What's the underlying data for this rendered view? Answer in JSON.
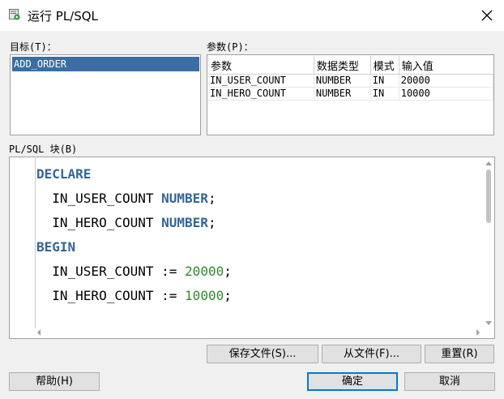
{
  "window": {
    "title": "运行 PL/SQL"
  },
  "target": {
    "label": "目标(T)：",
    "items": [
      "ADD_ORDER"
    ]
  },
  "params": {
    "label": "参数(P)：",
    "columns": [
      "参数",
      "数据类型",
      "模式",
      "输入值"
    ],
    "rows": [
      [
        "IN_USER_COUNT",
        "NUMBER",
        "IN",
        "20000"
      ],
      [
        "IN_HERO_COUNT",
        "NUMBER",
        "IN",
        "10000"
      ]
    ]
  },
  "block": {
    "label": "PL/SQL 块(B)",
    "code": {
      "l1": "DECLARE",
      "l2_name": "IN_USER_COUNT",
      "l2_type": "NUMBER",
      "l2_end": ";",
      "l3_name": "IN_HERO_COUNT",
      "l3_type": "NUMBER",
      "l3_end": ";",
      "l4": "BEGIN",
      "l5_name": "IN_USER_COUNT",
      "l5_op": ":=",
      "l5_val": "20000",
      "l5_end": ";",
      "l6_name": "IN_HERO_COUNT",
      "l6_op": ":=",
      "l6_val": "10000",
      "l6_end": ";"
    }
  },
  "buttons": {
    "save_file": "保存文件(S)...",
    "from_file": "从文件(F)...",
    "reset": "重置(R)",
    "help": "帮助(H)",
    "ok": "确定",
    "cancel": "取消"
  },
  "colors": {
    "selection": "#3a6ea5",
    "keyword": "#336699",
    "number": "#2e8b2e"
  }
}
